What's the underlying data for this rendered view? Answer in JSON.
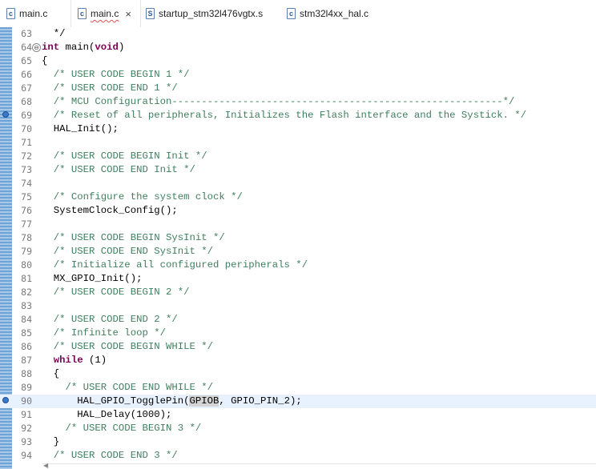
{
  "tabs": [
    {
      "label": "main.c",
      "icon": "c-file-icon",
      "active": false
    },
    {
      "label": "main.c",
      "icon": "c-file-icon",
      "active": true,
      "close": "×"
    },
    {
      "label": "startup_stm32l476vgtx.s",
      "icon": "asm-file-icon",
      "active": false
    },
    {
      "label": "stm32l4xx_hal.c",
      "icon": "c-file-icon",
      "active": false
    }
  ],
  "icon_glyphs": {
    "c": "c",
    "s": "S"
  },
  "colors": {
    "comment": "#3f7f5f",
    "keyword": "#7f0055",
    "current_line": "#e8f2fe",
    "selection": "#d4d4d4"
  },
  "lines": [
    {
      "n": "63",
      "text": "  */"
    },
    {
      "n": "64",
      "text": "int main(void)",
      "fold": "⊖"
    },
    {
      "n": "65",
      "text": "{"
    },
    {
      "n": "66",
      "text": "  /* USER CODE BEGIN 1 */"
    },
    {
      "n": "67",
      "text": "  /* USER CODE END 1 */"
    },
    {
      "n": "68",
      "text": "  /* MCU Configuration--------------------------------------------------------*/"
    },
    {
      "n": "69",
      "text": "  /* Reset of all peripherals, Initializes the Flash interface and the Systick. */"
    },
    {
      "n": "70",
      "text": "  HAL_Init();"
    },
    {
      "n": "71",
      "text": ""
    },
    {
      "n": "72",
      "text": "  /* USER CODE BEGIN Init */"
    },
    {
      "n": "73",
      "text": "  /* USER CODE END Init */"
    },
    {
      "n": "74",
      "text": ""
    },
    {
      "n": "75",
      "text": "  /* Configure the system clock */"
    },
    {
      "n": "76",
      "text": "  SystemClock_Config();"
    },
    {
      "n": "77",
      "text": ""
    },
    {
      "n": "78",
      "text": "  /* USER CODE BEGIN SysInit */"
    },
    {
      "n": "79",
      "text": "  /* USER CODE END SysInit */"
    },
    {
      "n": "80",
      "text": "  /* Initialize all configured peripherals */"
    },
    {
      "n": "81",
      "text": "  MX_GPIO_Init();"
    },
    {
      "n": "82",
      "text": "  /* USER CODE BEGIN 2 */"
    },
    {
      "n": "83",
      "text": ""
    },
    {
      "n": "84",
      "text": "  /* USER CODE END 2 */"
    },
    {
      "n": "85",
      "text": "  /* Infinite loop */"
    },
    {
      "n": "86",
      "text": "  /* USER CODE BEGIN WHILE */"
    },
    {
      "n": "87",
      "text": "  while (1)"
    },
    {
      "n": "88",
      "text": "  {"
    },
    {
      "n": "89",
      "text": "    /* USER CODE END WHILE */"
    },
    {
      "n": "90",
      "text": "      HAL_GPIO_TogglePin(GPIOB, GPIO_PIN_2);",
      "current": true,
      "highlight": "GPIOB"
    },
    {
      "n": "91",
      "text": "      HAL_Delay(1000);"
    },
    {
      "n": "92",
      "text": "    /* USER CODE BEGIN 3 */"
    },
    {
      "n": "93",
      "text": "  }"
    },
    {
      "n": "94",
      "text": "  /* USER CODE END 3 */"
    }
  ],
  "markers": [
    "69",
    "90"
  ]
}
